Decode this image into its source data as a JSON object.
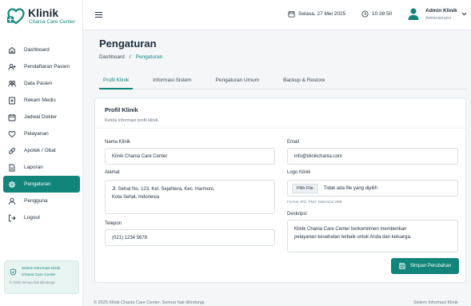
{
  "brand": {
    "title": "Klinik",
    "subtitle": "Chania Care Center"
  },
  "sidebar": {
    "items": [
      {
        "label": "Dashboard",
        "icon": "home-icon"
      },
      {
        "label": "Pendaftaran Pasien",
        "icon": "user-plus-icon"
      },
      {
        "label": "Data Pasien",
        "icon": "users-icon"
      },
      {
        "label": "Rekam Medis",
        "icon": "medical-record-icon"
      },
      {
        "label": "Jadwal Dokter",
        "icon": "calendar-icon"
      },
      {
        "label": "Pelayanan",
        "icon": "heart-icon"
      },
      {
        "label": "Apotek / Obat",
        "icon": "pill-icon"
      },
      {
        "label": "Laporan",
        "icon": "report-icon"
      },
      {
        "label": "Pengaturan",
        "icon": "gear-icon",
        "active": true
      },
      {
        "label": "Pengguna",
        "icon": "user-icon"
      },
      {
        "label": "Logout",
        "icon": "logout-icon"
      }
    ],
    "info_card": {
      "line1": "Sistem Informasi Klinik",
      "line2": "Chania Care Center",
      "line3": "© 2025 Semua hak dilindungi."
    }
  },
  "topbar": {
    "date": "Selasa, 27 Mei 2025",
    "time": "10:38:50",
    "user_name": "Admin Klinik",
    "user_role": "Administrator"
  },
  "page": {
    "title": "Pengaturan",
    "breadcrumb": {
      "home": "Dashboard",
      "separator": "/",
      "current": "Pengaturan"
    }
  },
  "tabs": [
    {
      "label": "Profil Klinik",
      "active": true
    },
    {
      "label": "Informasi Sistem"
    },
    {
      "label": "Pengaturan Umum"
    },
    {
      "label": "Backup & Restore"
    }
  ],
  "form": {
    "title": "Profil Klinik",
    "description": "Kelola informasi profil klinik.",
    "nama_label": "Nama Klinik",
    "nama_value": "Klinik Chania Care Center",
    "email_label": "Email",
    "email_value": "info@klinikchania.com",
    "alamat_label": "Alamat",
    "alamat_line1": "Jl. Sehat No. 123, Kel. Sejahtera, Kec. Harmoni,",
    "alamat_line2": "Kota Sehat, Indonesia",
    "logo_label": "Logo Klinik",
    "logo_button": "Pilih File",
    "logo_status": "Tidak ada file yang dipilih",
    "logo_hint": "Format JPG, PNG. Maksimal 2MB.",
    "telepon_label": "Telepon",
    "telepon_value": "(021) 1234 5678",
    "deskripsi_label": "Deskripsi",
    "deskripsi_line1": "Klinik Chania Care Center berkomitmen memberikan",
    "deskripsi_line2": "pelayanan kesehatan terbaik untuk Anda dan keluarga.",
    "save_label": "Simpan Perubahan"
  },
  "footer": {
    "left": "© 2025 Klinik Chania Care Center. Semua hak dilindungi.",
    "right": "Sistem Informasi Klinik"
  },
  "colors": {
    "accent": "#12857b",
    "accent_light": "#e8f4f2",
    "background": "#f4f6f8"
  }
}
